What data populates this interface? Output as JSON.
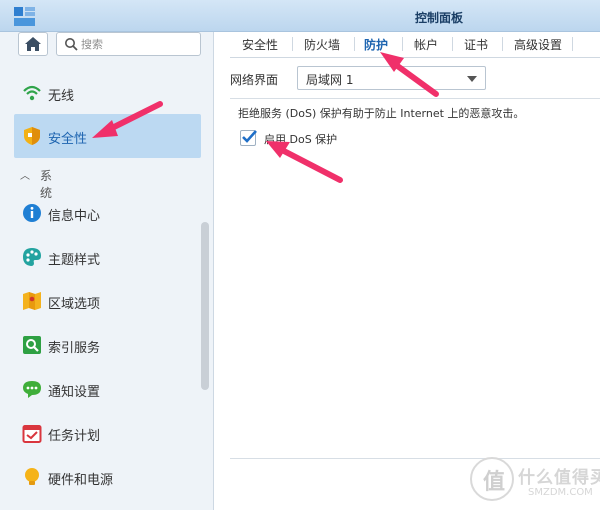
{
  "window": {
    "title": "控制面板"
  },
  "search": {
    "placeholder": "搜索"
  },
  "sidebar": {
    "items": [
      {
        "label": "无线",
        "icon": "wifi-icon"
      },
      {
        "label": "安全性",
        "icon": "shield-icon",
        "active": true
      },
      {
        "label": "信息中心",
        "icon": "info-icon"
      },
      {
        "label": "主题样式",
        "icon": "palette-icon"
      },
      {
        "label": "区域选项",
        "icon": "map-icon"
      },
      {
        "label": "索引服务",
        "icon": "index-search-icon"
      },
      {
        "label": "通知设置",
        "icon": "chat-bubble-icon"
      },
      {
        "label": "任务计划",
        "icon": "calendar-icon"
      },
      {
        "label": "硬件和电源",
        "icon": "lightbulb-icon"
      }
    ],
    "section": {
      "label": "系统",
      "expanded": true
    }
  },
  "tabs": [
    {
      "label": "安全性"
    },
    {
      "label": "防火墙"
    },
    {
      "label": "防护",
      "active": true
    },
    {
      "label": "帐户"
    },
    {
      "label": "证书"
    },
    {
      "label": "高级设置"
    }
  ],
  "protection": {
    "interface_label": "网络界面",
    "interface_value": "局域网 1",
    "description": "拒绝服务 (DoS) 保护有助于防止 Internet 上的恶意攻击。",
    "dos_checkbox_label": "启用 DoS 保护",
    "dos_enabled": true
  },
  "watermark": {
    "cn": "什么值得买",
    "en": "SMZDM.COM",
    "logo_char": "值"
  },
  "colors": {
    "accent": "#1d64b0",
    "active_bg": "#bcd9f2",
    "arrow": "#f0306a"
  }
}
